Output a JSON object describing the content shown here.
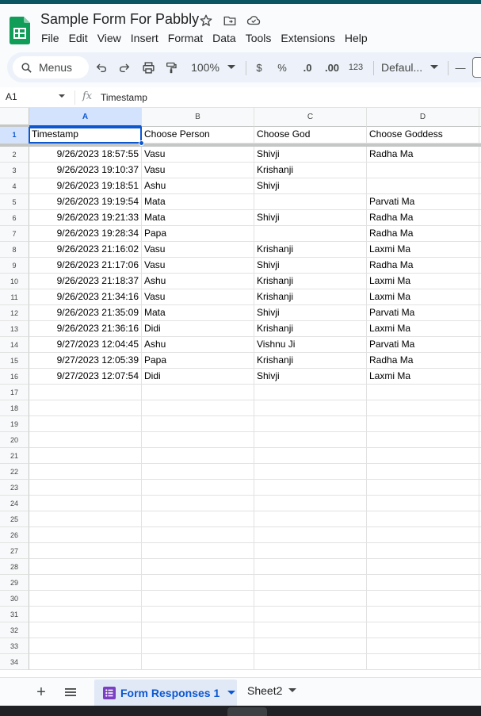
{
  "app": {
    "title": "Sample Form For Pabbly",
    "menu": [
      "File",
      "Edit",
      "View",
      "Insert",
      "Format",
      "Data",
      "Tools",
      "Extensions",
      "Help"
    ]
  },
  "toolbar": {
    "search_label": "Menus",
    "zoom": "100%",
    "currency": "$",
    "percent": "%",
    "decrease_decimal": ".0",
    "increase_decimal": ".00",
    "number_format": "123",
    "font": "Defaul...",
    "font_size_minus": "—"
  },
  "formula_bar": {
    "cell_ref": "A1",
    "fx": "fx",
    "value": "Timestamp"
  },
  "sheet": {
    "columns": [
      "A",
      "B",
      "C",
      "D"
    ],
    "header_row": [
      "Timestamp",
      "Choose Person",
      "Choose God",
      "Choose Goddess"
    ],
    "rows": [
      [
        "9/26/2023 18:57:55",
        "Vasu",
        "Shivji",
        "Radha Ma"
      ],
      [
        "9/26/2023 19:10:37",
        "Vasu",
        "Krishanji",
        ""
      ],
      [
        "9/26/2023 19:18:51",
        "Ashu",
        "Shivji",
        ""
      ],
      [
        "9/26/2023 19:19:54",
        "Mata",
        "",
        "Parvati Ma"
      ],
      [
        "9/26/2023 19:21:33",
        "Mata",
        "Shivji",
        "Radha Ma"
      ],
      [
        "9/26/2023 19:28:34",
        "Papa",
        "",
        "Radha Ma"
      ],
      [
        "9/26/2023 21:16:02",
        "Vasu",
        "Krishanji",
        "Laxmi Ma"
      ],
      [
        "9/26/2023 21:17:06",
        "Vasu",
        "Shivji",
        "Radha Ma"
      ],
      [
        "9/26/2023 21:18:37",
        "Ashu",
        "Krishanji",
        "Laxmi Ma"
      ],
      [
        "9/26/2023 21:34:16",
        "Vasu",
        "Krishanji",
        "Laxmi Ma"
      ],
      [
        "9/26/2023 21:35:09",
        "Mata",
        "Shivji",
        "Parvati Ma"
      ],
      [
        "9/26/2023 21:36:16",
        "Didi",
        "Krishanji",
        "Laxmi Ma"
      ],
      [
        "9/27/2023 12:04:45",
        "Ashu",
        "Vishnu Ji",
        "Parvati Ma"
      ],
      [
        "9/27/2023 12:05:39",
        "Papa",
        "Krishanji",
        "Radha Ma"
      ],
      [
        "9/27/2023 12:07:54",
        "Didi",
        "Shivji",
        "Laxmi Ma"
      ]
    ],
    "row_numbers": [
      "1",
      "2",
      "3",
      "4",
      "5",
      "6",
      "7",
      "8",
      "9",
      "10",
      "11",
      "12",
      "13",
      "14",
      "15",
      "16",
      "17",
      "18",
      "19",
      "20",
      "21",
      "22",
      "23",
      "24",
      "25",
      "26",
      "27",
      "28",
      "29",
      "30",
      "31",
      "32",
      "33",
      "34"
    ]
  },
  "sheet_tabs": {
    "active": "Form Responses 1",
    "other": "Sheet2",
    "add": "+",
    "all_sheets": "≡"
  },
  "colors": {
    "accent": "#0b57d0",
    "logo_green": "#0f9d58",
    "form_icon_purple": "#7b3fc4"
  }
}
